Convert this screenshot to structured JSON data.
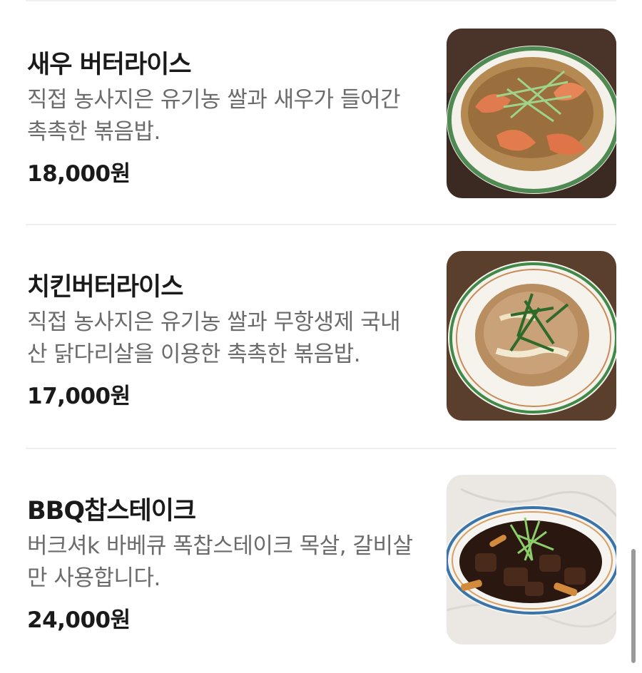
{
  "menu": {
    "items": [
      {
        "name": "새우 버터라이스",
        "description": "직접 농사지은 유기농 쌀과 새우가 들어간 촉촉한 볶음밥.",
        "price": "18,000원",
        "image_icon": "shrimp-butter-rice-photo"
      },
      {
        "name": "치킨버터라이스",
        "description": "직접 농사지은 유기농 쌀과 무항생제 국내산 닭다리살을 이용한 촉촉한 볶음밥.",
        "price": "17,000원",
        "image_icon": "chicken-butter-rice-photo"
      },
      {
        "name": "BBQ찹스테이크",
        "description": "버크셔k 바베큐 폭찹스테이크 목살, 갈비살만 사용합니다.",
        "price": "24,000원",
        "image_icon": "bbq-chop-steak-photo"
      }
    ]
  },
  "colors": {
    "title": "#1a1a1a",
    "description": "#6b6b6b",
    "divider": "#efefef",
    "scrollbar": "#9a9a9a"
  }
}
